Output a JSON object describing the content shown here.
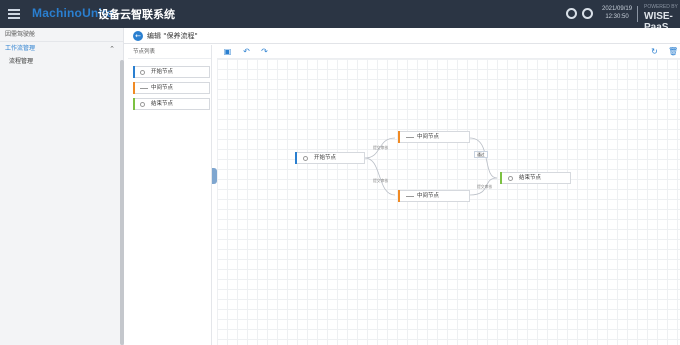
{
  "header": {
    "brand": "MachinoUnite",
    "app_title": "设备云智联系统",
    "datetime_date": "2021/09/19",
    "datetime_time": "12:30:50",
    "powered_by": "POWERED BY",
    "platform": "WISE-PaaS"
  },
  "sidebar": {
    "top_item": "因需驾驶舱",
    "group_label": "工作流管理",
    "items": [
      {
        "label": "流程管理"
      }
    ]
  },
  "page": {
    "title": "编辑 \"保养流程\""
  },
  "node_panel": {
    "title": "节点列表",
    "items": [
      {
        "label": "开始节点",
        "color": "#2a7fd0",
        "icon": "circle-icon"
      },
      {
        "label": "中间节点",
        "color": "#f08a24",
        "icon": "dash-icon"
      },
      {
        "label": "结束节点",
        "color": "#7cc142",
        "icon": "circle-icon"
      }
    ]
  },
  "toolbar": {
    "icons": [
      "save-icon",
      "undo-icon",
      "redo-icon",
      "refresh-icon",
      "delete-icon"
    ]
  },
  "flow": {
    "nodes": [
      {
        "id": "start",
        "label": "开始节点",
        "color": "#2a7fd0"
      },
      {
        "id": "mid1",
        "label": "中间节点",
        "color": "#f08a24"
      },
      {
        "id": "mid2",
        "label": "中间节点",
        "color": "#f08a24"
      },
      {
        "id": "end",
        "label": "结束节点",
        "color": "#7cc142"
      }
    ],
    "edges": [
      {
        "label": "提交审核"
      },
      {
        "label": "提交审核"
      },
      {
        "label": "通过"
      },
      {
        "label": "提交审核"
      }
    ]
  },
  "colors": {
    "topbar": "#2b3544",
    "accent": "#2a7fd0",
    "orange": "#f08a24",
    "green": "#7cc142"
  }
}
